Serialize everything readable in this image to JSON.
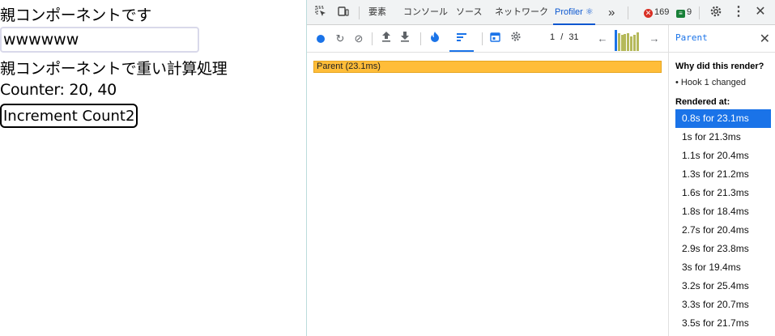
{
  "app": {
    "title": "親コンポーネントです",
    "input_value": "wwwwww",
    "heavy_text": "親コンポーネントで重い計算処理",
    "counter_text": "Counter: 20, 40",
    "button_label": "Increment Count2"
  },
  "devtools": {
    "tabs": [
      {
        "label": "要素"
      },
      {
        "label": "コンソール"
      },
      {
        "label": "ソース"
      },
      {
        "label": "ネットワーク"
      },
      {
        "label": "Profiler ⚛"
      }
    ],
    "more_tabs": "»",
    "error_count": "169",
    "message_count": "9",
    "commit_index": "1",
    "commit_separator": "/",
    "commit_total": "31",
    "commit_bars": [
      0.92,
      0.78,
      0.72,
      0.76,
      0.78,
      0.66,
      0.72,
      0.82
    ],
    "flame_bar_label": "Parent (23.1ms)",
    "colors": {
      "accent": "#1a73e8",
      "bar": "#ffbd39",
      "commit_bar": "#b5b95a"
    }
  },
  "side": {
    "title": "Parent",
    "why_title": "Why did this render?",
    "why_reason": "• Hook 1 changed",
    "rendered_title": "Rendered at:",
    "renders": [
      "0.8s for 23.1ms",
      "1s for 21.3ms",
      "1.1s for 20.4ms",
      "1.3s for 21.2ms",
      "1.6s for 21.3ms",
      "1.8s for 18.4ms",
      "2.7s for 20.4ms",
      "2.9s for 23.8ms",
      "3s for 19.4ms",
      "3.2s for 25.4ms",
      "3.3s for 20.7ms",
      "3.5s for 21.7ms"
    ]
  }
}
